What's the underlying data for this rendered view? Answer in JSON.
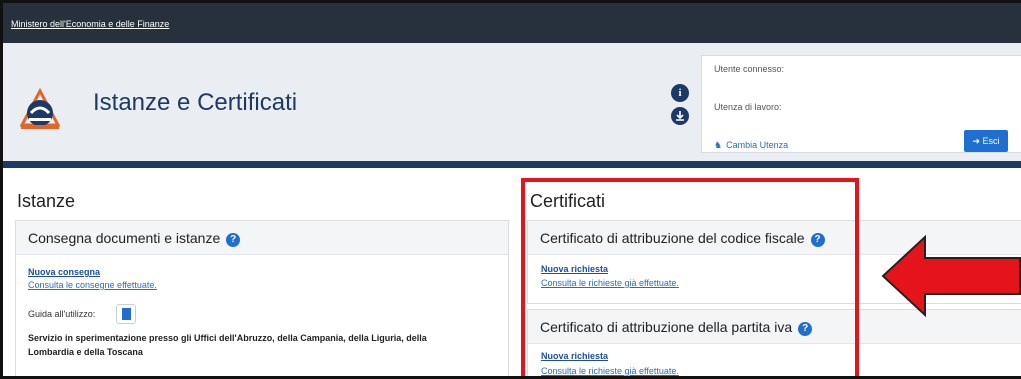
{
  "topbar": {
    "ministry_link": "Ministero dell'Economia e delle Finanze"
  },
  "header": {
    "app_title": "Istanze e Certificati",
    "info_icon": "i",
    "user": {
      "connected_label": "Utente connesso:",
      "work_label": "Utenza di lavoro:",
      "change_user_label": "Cambia Utenza",
      "exit_label": "Esci"
    }
  },
  "istanze": {
    "section_title": "Istanze",
    "panel_title": "Consegna documenti e istanze",
    "new_link": "Nuova consegna",
    "consult_link": "Consulta le consegne effettuate.",
    "guide_label": "Guida all'utilizzo:",
    "service_text_1": "Servizio in sperimentazione presso gli Uffici dell'Abruzzo, della Campania, della Liguria, della",
    "service_text_2": "Lombardia e della Toscana"
  },
  "certificati": {
    "section_title": "Certificati",
    "panel1_title": "Certificato di attribuzione del codice fiscale",
    "panel1_new_link": "Nuova richiesta",
    "panel1_consult_link": "Consulta le richieste già effettuate.",
    "panel2_title": "Certificato di attribuzione della partita iva",
    "panel2_new_link": "Nuova richiesta",
    "panel2_consult_link": "Consulta le richieste già effettuate."
  },
  "icons": {
    "help": "?",
    "logo": "agenzia-entrate-logo-icon",
    "exit": "sign-out-icon",
    "users": "users-icon",
    "pdf": "document-icon",
    "arrow": "red-arrow-icon"
  },
  "colors": {
    "topbar": "#27303d",
    "header_bg": "#eaedf2",
    "brand_blue": "#1d3a67",
    "accent_blue": "#1f6fd1",
    "highlight_red": "#e4141a"
  }
}
